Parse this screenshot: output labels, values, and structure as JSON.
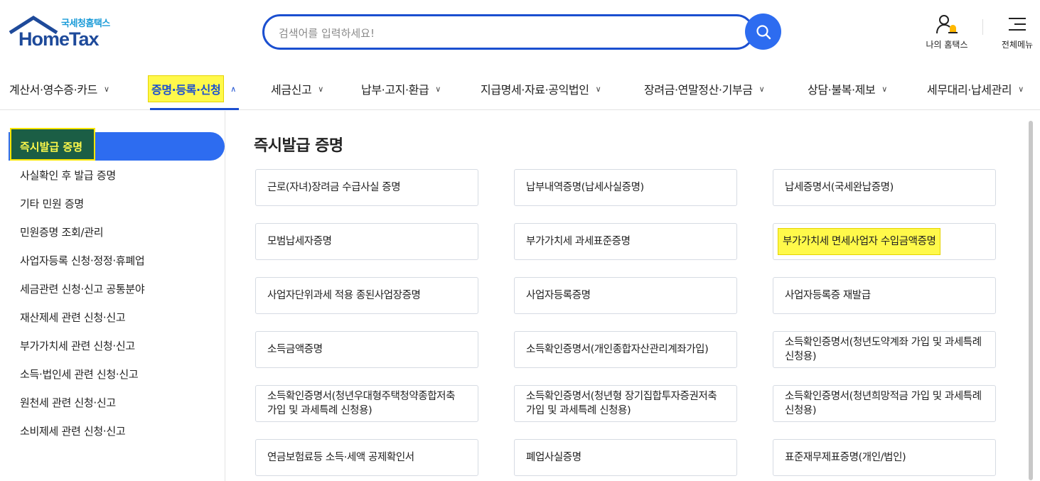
{
  "header": {
    "logo_sub": "국세청홈택스",
    "logo_main": "HomeTax",
    "search_placeholder": "검색어를 입력하세요!",
    "my_hometax_label": "나의 홈택스",
    "all_menu_label": "전체메뉴"
  },
  "topnav": [
    {
      "label": "계산서·영수증·카드",
      "active": false
    },
    {
      "label": "증명·등록·신청",
      "active": true
    },
    {
      "label": "세금신고",
      "active": false
    },
    {
      "label": "납부·고지·환급",
      "active": false
    },
    {
      "label": "지급명세·자료·공익법인",
      "active": false
    },
    {
      "label": "장려금·연말정산·기부금",
      "active": false
    },
    {
      "label": "상담·불복·제보",
      "active": false
    },
    {
      "label": "세무대리·납세관리",
      "active": false
    }
  ],
  "sidebar": {
    "active": "즉시발급 증명",
    "items": [
      "사실확인 후 발급 증명",
      "기타 민원 증명",
      "민원증명 조회/관리",
      "사업자등록 신청·정정·휴폐업",
      "세금관련 신청·신고 공통분야",
      "재산제세 관련 신청·신고",
      "부가가치세 관련 신청·신고",
      "소득·법인세 관련 신청·신고",
      "원천세 관련 신청·신고",
      "소비제세 관련 신청·신고"
    ]
  },
  "main": {
    "title": "즉시발급 증명",
    "cards": [
      "근로(자녀)장려금 수급사실 증명",
      "납부내역증명(납세사실증명)",
      "납세증명서(국세완납증명)",
      "모범납세자증명",
      "부가가치세 과세표준증명",
      "부가가치세 면세사업자 수입금액증명",
      "사업자단위과세 적용 종된사업장증명",
      "사업자등록증명",
      "사업자등록증 재발급",
      "소득금액증명",
      "소득확인증명서(개인종합자산관리계좌가입)",
      "소득확인증명서(청년도약계좌 가입 및 과세특례 신청용)",
      "소득확인증명서(청년우대형주택청약종합저축 가입 및 과세특례 신청용)",
      "소득확인증명서(청년형 장기집합투자증권저축 가입 및 과세특례 신청용)",
      "소득확인증명서(청년희망적금 가입 및 과세특례 신청용)",
      "연금보험료등 소득·세액 공제확인서",
      "폐업사실증명",
      "표준재무제표증명(개인/법인)"
    ],
    "highlighted_card_index": 5
  },
  "colors": {
    "brand_blue": "#1b4fd0",
    "button_blue": "#2d6cf0",
    "highlight_yellow": "#fff94a",
    "logo_dark": "#1e4a9a"
  }
}
